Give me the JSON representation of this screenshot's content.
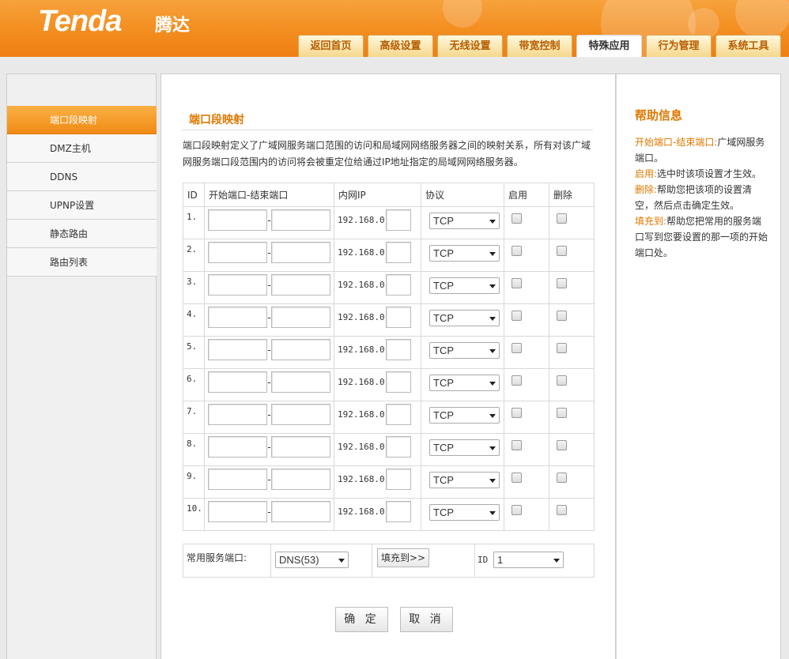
{
  "brand": {
    "logo": "Tenda",
    "logo_cn": "腾达",
    "accent": "#f08a14"
  },
  "tabs": [
    {
      "label": "返回首页"
    },
    {
      "label": "高级设置"
    },
    {
      "label": "无线设置"
    },
    {
      "label": "带宽控制"
    },
    {
      "label": "特殊应用",
      "active": true
    },
    {
      "label": "行为管理"
    },
    {
      "label": "系统工具"
    }
  ],
  "sidebar": {
    "items": [
      {
        "label": "端口段映射",
        "active": true
      },
      {
        "label": "DMZ主机"
      },
      {
        "label": "DDNS"
      },
      {
        "label": "UPNP设置"
      },
      {
        "label": "静态路由"
      },
      {
        "label": "路由列表"
      }
    ]
  },
  "main": {
    "title": "端口段映射",
    "description": "端口段映射定义了广域网服务端口范围的访问和局域网网络服务器之间的映射关系，所有对该广域网服务端口段范围内的访问将会被重定位给通过IP地址指定的局域网网络服务器。",
    "table": {
      "headers": {
        "id": "ID",
        "port": "开始端口-结束端口",
        "ip": "内网IP",
        "proto": "协议",
        "enable": "启用",
        "delete": "删除"
      },
      "rows": [
        {
          "id": "1.",
          "ip_prefix": "192.168.0.",
          "protocol": "TCP",
          "dash": "-"
        },
        {
          "id": "2.",
          "ip_prefix": "192.168.0.",
          "protocol": "TCP",
          "dash": "-"
        },
        {
          "id": "3.",
          "ip_prefix": "192.168.0.",
          "protocol": "TCP",
          "dash": "-"
        },
        {
          "id": "4.",
          "ip_prefix": "192.168.0.",
          "protocol": "TCP",
          "dash": "-"
        },
        {
          "id": "5.",
          "ip_prefix": "192.168.0.",
          "protocol": "TCP",
          "dash": "-"
        },
        {
          "id": "6.",
          "ip_prefix": "192.168.0.",
          "protocol": "TCP",
          "dash": "-"
        },
        {
          "id": "7.",
          "ip_prefix": "192.168.0.",
          "protocol": "TCP",
          "dash": "-"
        },
        {
          "id": "8.",
          "ip_prefix": "192.168.0.",
          "protocol": "TCP",
          "dash": "-"
        },
        {
          "id": "9.",
          "ip_prefix": "192.168.0.",
          "protocol": "TCP",
          "dash": "-"
        },
        {
          "id": "10.",
          "ip_prefix": "192.168.0.",
          "protocol": "TCP",
          "dash": "-"
        }
      ]
    },
    "service": {
      "label": "常用服务端口:",
      "selected": "DNS(53)",
      "fill_button": "填充到>>",
      "id_label": "ID",
      "id_selected": "1"
    },
    "confirm": "确 定",
    "cancel": "取 消"
  },
  "help": {
    "title": "帮助信息",
    "items": [
      {
        "key": "开始端口-结束端口:",
        "text": "广域网服务端口。"
      },
      {
        "key": "启用:",
        "text": "选中时该项设置才生效。"
      },
      {
        "key": "删除:",
        "text": "帮助您把该项的设置清空，然后点击确定生效。"
      },
      {
        "key": "填充到:",
        "text": "帮助您把常用的服务端口写到您要设置的那一项的开始端口处。"
      }
    ]
  }
}
